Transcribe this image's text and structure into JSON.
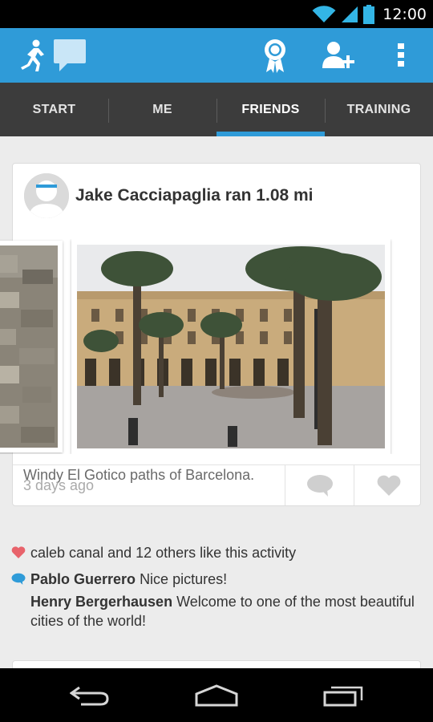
{
  "status_bar": {
    "time": "12:00",
    "icons": [
      "wifi-icon",
      "signal-icon",
      "battery-icon"
    ]
  },
  "action_bar": {
    "icons": [
      "runner-logo-icon",
      "chat-bubble-icon",
      "award-ribbon-icon",
      "add-friend-icon",
      "overflow-menu-icon"
    ],
    "color": "#2f9bd8"
  },
  "tabs": [
    {
      "label": "START",
      "active": false
    },
    {
      "label": "ME",
      "active": false
    },
    {
      "label": "FRIENDS",
      "active": true
    },
    {
      "label": "TRAINING",
      "active": false
    }
  ],
  "activity": {
    "title": "Jake Cacciapaglia ran 1.08 mi",
    "caption": "Windy El Gotico paths of Barcelona.",
    "timestamp": "3 days ago",
    "photos": [
      "stone-wall-photo",
      "barcelona-plaza-photo"
    ]
  },
  "social": {
    "likes_text": "caleb canal and 12 others like this activity",
    "comments": [
      {
        "author": "Pablo Guerrero",
        "text": "Nice pictures!"
      },
      {
        "author": "Henry Bergerhausen",
        "text": "Welcome to one of the most beautiful cities of the world!"
      }
    ]
  },
  "colors": {
    "accent": "#2f9bd8",
    "like": "#e8636b",
    "comment": "#2f9bd8"
  },
  "nav_bar": {
    "icons": [
      "back-icon",
      "home-icon",
      "recents-icon"
    ]
  }
}
